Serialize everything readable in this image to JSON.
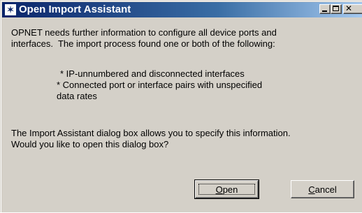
{
  "window": {
    "title": "Open Import Assistant",
    "icon": "star-icon",
    "titlebar_color": "#0a246a",
    "caption_buttons": [
      "minimize",
      "maximize",
      "close"
    ]
  },
  "message": {
    "intro": "OPNET needs further information to configure all device ports and\ninterfaces.  The import process found one or both of the following:",
    "item1": "* IP-unnumbered and disconnected interfaces",
    "item2": "* Connected port or interface pairs with unspecified",
    "item2_cont": "data rates",
    "question": "The Import Assistant dialog box allows you to specify this information.\nWould you like to open this dialog box?"
  },
  "buttons": {
    "open_first": "O",
    "open_rest": "pen",
    "cancel_first": "C",
    "cancel_rest": "ancel"
  }
}
